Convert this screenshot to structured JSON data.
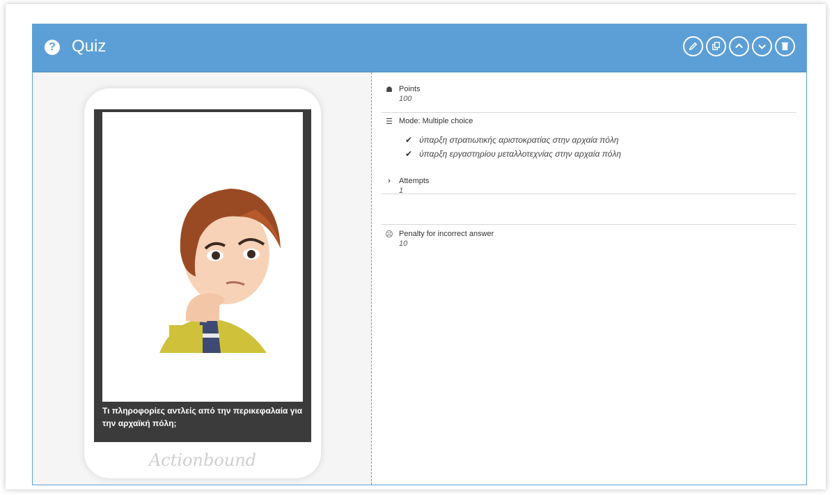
{
  "header": {
    "title": "Quiz",
    "help_icon": "?",
    "actions": [
      "edit",
      "duplicate",
      "move-up",
      "move-down",
      "delete"
    ]
  },
  "preview": {
    "caption": "Τι πληροφορίες αντλείς από την περικεφαλαία για την αρχαϊκή πόλη;",
    "brand": "Actionbound",
    "image": "thinking woman avatar"
  },
  "details": {
    "points": {
      "label": "Points",
      "value": "100",
      "icon": "trophy-icon"
    },
    "mode": {
      "label": "Mode: Multiple choice",
      "icon": "list-icon",
      "answers": [
        "ύπαρξη στρατιωτικής αριστοκρατίας στην αρχαία πόλη",
        "ύπαρξη εργαστηρίου μεταλλοτεχνίας στην αρχαία πόλη"
      ]
    },
    "attempts": {
      "label": "Attempts",
      "value": "1",
      "icon": "chevron-right-icon"
    },
    "penalty": {
      "label": "Penalty for incorrect answer",
      "value": "10",
      "icon": "frown-icon"
    }
  },
  "colors": {
    "header": "#5c9fd6",
    "border": "#5ba0d6",
    "phone_screen": "#3b3b3b"
  }
}
